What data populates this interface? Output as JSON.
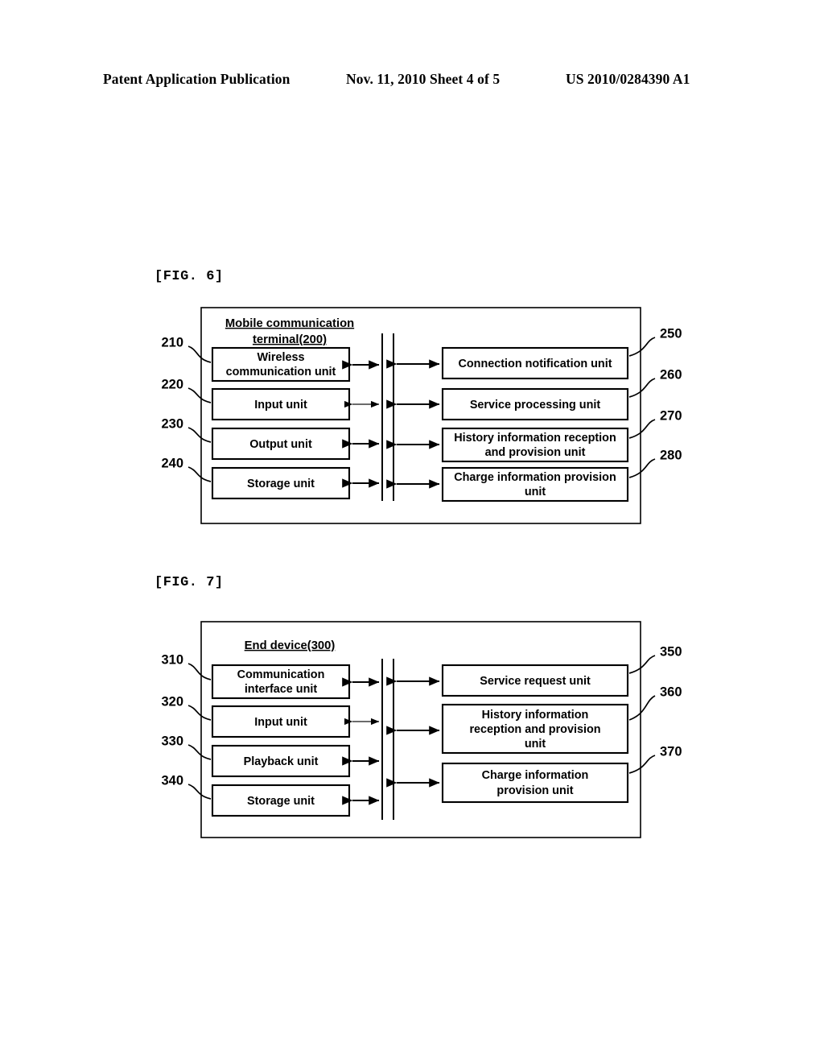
{
  "header": {
    "left": "Patent Application Publication",
    "middle": "Nov. 11, 2010  Sheet 4 of 5",
    "right": "US 2010/0284390 A1"
  },
  "figures": [
    {
      "label": "[FIG. 6]",
      "title": "Mobile communication terminal(200)",
      "title_lines": [
        "Mobile communication",
        "terminal(200)"
      ],
      "left_units": [
        {
          "ref": "210",
          "label": "Wireless communication unit",
          "lines": [
            "Wireless",
            "communication unit"
          ]
        },
        {
          "ref": "220",
          "label": "Input unit",
          "lines": [
            "Input unit"
          ]
        },
        {
          "ref": "230",
          "label": "Output unit",
          "lines": [
            "Output unit"
          ]
        },
        {
          "ref": "240",
          "label": "Storage unit",
          "lines": [
            "Storage unit"
          ]
        }
      ],
      "right_units": [
        {
          "ref": "250",
          "label": "Connection notification unit",
          "lines": [
            "Connection notification unit"
          ]
        },
        {
          "ref": "260",
          "label": "Service processing unit",
          "lines": [
            "Service processing unit"
          ]
        },
        {
          "ref": "270",
          "label": "History information reception and provision unit",
          "lines": [
            "History information reception",
            "and provision unit"
          ]
        },
        {
          "ref": "280",
          "label": "Charge information provision unit",
          "lines": [
            "Charge information provision",
            "unit"
          ]
        }
      ]
    },
    {
      "label": "[FIG. 7]",
      "title": "End device(300)",
      "title_lines": [
        "End device(300)"
      ],
      "left_units": [
        {
          "ref": "310",
          "label": "Communication interface unit",
          "lines": [
            "Communication",
            "interface unit"
          ]
        },
        {
          "ref": "320",
          "label": "Input unit",
          "lines": [
            "Input unit"
          ]
        },
        {
          "ref": "330",
          "label": "Playback unit",
          "lines": [
            "Playback unit"
          ]
        },
        {
          "ref": "340",
          "label": "Storage unit",
          "lines": [
            "Storage unit"
          ]
        }
      ],
      "right_units": [
        {
          "ref": "350",
          "label": "Service request unit",
          "lines": [
            "Service request unit"
          ]
        },
        {
          "ref": "360",
          "label": "History information reception and provision unit",
          "lines": [
            "History information",
            "reception and provision",
            "unit"
          ]
        },
        {
          "ref": "370",
          "label": "Charge information provision unit",
          "lines": [
            "Charge information",
            "provision unit"
          ]
        }
      ]
    }
  ],
  "colors": {
    "ink": "#000000",
    "paper": "#ffffff"
  }
}
